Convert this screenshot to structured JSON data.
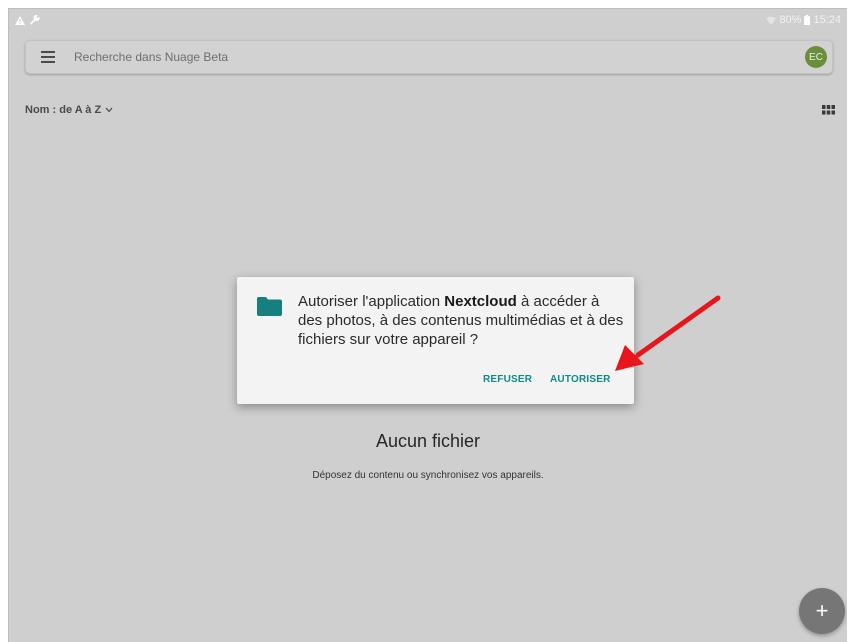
{
  "status_bar": {
    "left_icons": [
      "alert-icon",
      "wrench-icon"
    ],
    "battery": "80%",
    "time": "15:24"
  },
  "search": {
    "placeholder": "Recherche dans Nuage Beta",
    "avatar_initials": "EC",
    "avatar_color": "#6b8e3d"
  },
  "sort": {
    "label": "Nom : de A à Z"
  },
  "empty_state": {
    "title": "Aucun fichier",
    "subtitle": "Déposez du contenu ou synchronisez vos appareils."
  },
  "dialog": {
    "text_before": "Autoriser l'application ",
    "app_name": "Nextcloud",
    "text_after": " à accéder à des photos, à des contenus multimédias et à des fichiers sur votre appareil ?",
    "deny_label": "REFUSER",
    "allow_label": "AUTORISER",
    "accent_color": "#0f8a88"
  },
  "fab": {
    "label": "+"
  },
  "annotation": {
    "color": "#e8161c"
  }
}
